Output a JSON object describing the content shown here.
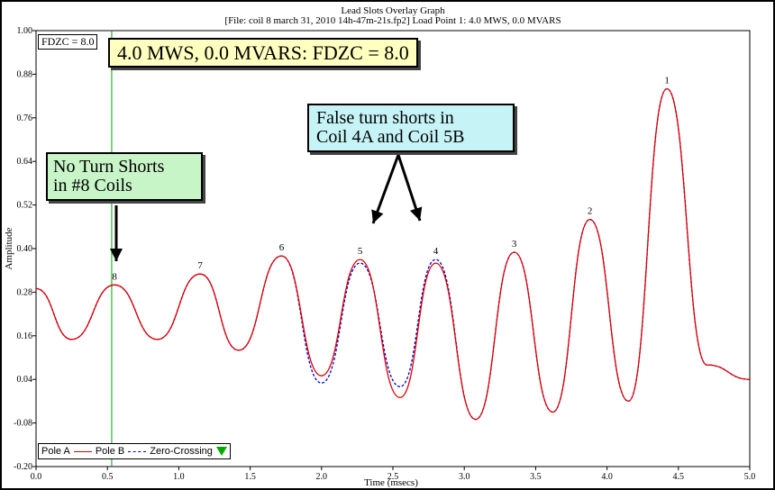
{
  "header": {
    "title": "Lead Slots Overlay Graph",
    "subtitle": "[File: coil 8 march 31, 2010  14h-47m-21s.fp2]  Load Point 1:   4.0 MWS,   0.0 MVARS"
  },
  "annotations": {
    "fdzc_label": "FDZC = 8.0",
    "title_box": "4.0 MWS, 0.0 MVARS: FDZC = 8.0",
    "no_shorts_line1": "No Turn Shorts",
    "no_shorts_line2": "in #8 Coils",
    "false_shorts_line1": "False turn shorts in",
    "false_shorts_line2": "Coil 4A and Coil 5B"
  },
  "legend": {
    "pole_a": "Pole A",
    "pole_b": "Pole B",
    "zero_crossing": "Zero-Crossing"
  },
  "colors": {
    "pole_a": "#0000cc",
    "pole_b": "#dd0000",
    "zero_crossing": "#00a000",
    "title_box_bg": "#ffffc0",
    "green_box_bg": "#c8f5c8",
    "cyan_box_bg": "#c6f3f6"
  },
  "chart_data": {
    "type": "line",
    "title": "Lead Slots Overlay Graph",
    "xlabel": "Time (msecs)",
    "ylabel": "Amplitude",
    "xlim": [
      0.0,
      5.0
    ],
    "ylim": [
      -0.2,
      1.0
    ],
    "x_ticks": [
      "0.0",
      "0.5",
      "1.0",
      "1.5",
      "2.0",
      "2.5",
      "3.0",
      "3.5",
      "4.0",
      "4.5",
      "5.0"
    ],
    "y_ticks": [
      "-0.20",
      "-0.08",
      "0.04",
      "0.16",
      "0.28",
      "0.40",
      "0.52",
      "0.64",
      "0.76",
      "0.88",
      "1.00"
    ],
    "zero_crossing_x": 0.53,
    "series": [
      {
        "name": "Pole A",
        "x": [
          0.0,
          0.25,
          0.55,
          0.85,
          1.15,
          1.42,
          1.72,
          2.0,
          2.27,
          2.55,
          2.8,
          3.08,
          3.35,
          3.62,
          3.88,
          4.15,
          4.42,
          4.7,
          5.0
        ],
        "y": [
          0.29,
          0.15,
          0.3,
          0.15,
          0.33,
          0.12,
          0.38,
          0.03,
          0.36,
          0.02,
          0.37,
          -0.07,
          0.39,
          -0.05,
          0.48,
          -0.02,
          0.84,
          0.08,
          0.04
        ]
      },
      {
        "name": "Pole B",
        "x": [
          0.0,
          0.25,
          0.55,
          0.85,
          1.15,
          1.42,
          1.72,
          2.0,
          2.27,
          2.55,
          2.8,
          3.08,
          3.35,
          3.62,
          3.88,
          4.15,
          4.42,
          4.7,
          5.0
        ],
        "y": [
          0.29,
          0.15,
          0.3,
          0.15,
          0.33,
          0.12,
          0.38,
          0.05,
          0.37,
          -0.01,
          0.36,
          -0.07,
          0.39,
          -0.05,
          0.48,
          -0.02,
          0.84,
          0.08,
          0.04
        ]
      }
    ],
    "peak_labels": [
      {
        "text": "8",
        "x": 0.55,
        "y": 0.3
      },
      {
        "text": "7",
        "x": 1.15,
        "y": 0.33
      },
      {
        "text": "6",
        "x": 1.72,
        "y": 0.38
      },
      {
        "text": "5",
        "x": 2.27,
        "y": 0.37
      },
      {
        "text": "4",
        "x": 2.8,
        "y": 0.37
      },
      {
        "text": "3",
        "x": 3.35,
        "y": 0.39
      },
      {
        "text": "2",
        "x": 3.88,
        "y": 0.48
      },
      {
        "text": "1",
        "x": 4.42,
        "y": 0.84
      }
    ]
  }
}
